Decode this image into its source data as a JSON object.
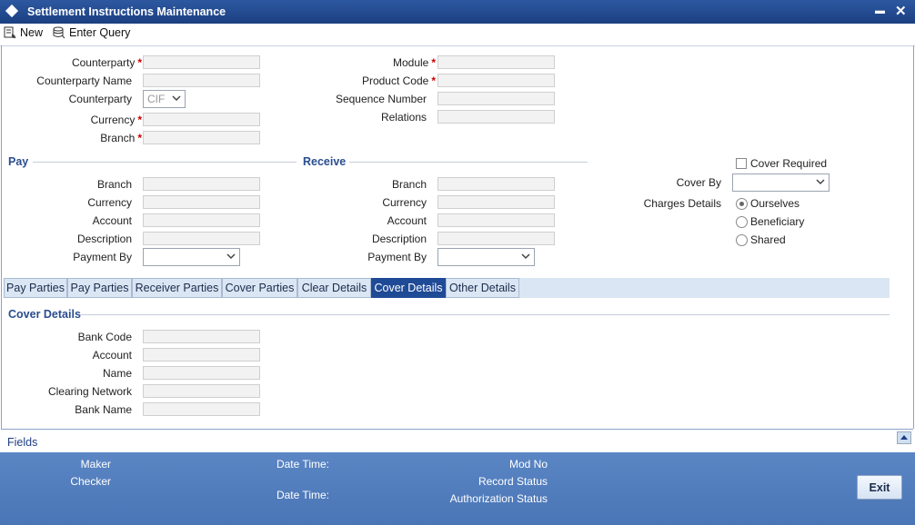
{
  "window": {
    "title": "Settlement Instructions Maintenance",
    "minimize_glyph": "▬",
    "close_glyph": "✕"
  },
  "toolbar": {
    "new_label": "New",
    "enter_query_label": "Enter Query"
  },
  "header": {
    "counterparty_label": "Counterparty",
    "counterparty_name_label": "Counterparty Name",
    "counterparty_type_label": "Counterparty",
    "counterparty_type_value": "CIF",
    "currency_label": "Currency",
    "branch_label": "Branch",
    "module_label": "Module",
    "product_code_label": "Product Code",
    "sequence_number_label": "Sequence Number",
    "relations_label": "Relations",
    "required_marker": "*"
  },
  "pay": {
    "title": "Pay",
    "branch_label": "Branch",
    "currency_label": "Currency",
    "account_label": "Account",
    "description_label": "Description",
    "payment_by_label": "Payment By"
  },
  "receive": {
    "title": "Receive",
    "branch_label": "Branch",
    "currency_label": "Currency",
    "account_label": "Account",
    "description_label": "Description",
    "payment_by_label": "Payment By"
  },
  "cover": {
    "cover_required_label": "Cover Required",
    "cover_by_label": "Cover By",
    "charges_details_label": "Charges Details",
    "charges_options": [
      "Ourselves",
      "Beneficiary",
      "Shared"
    ],
    "charges_selected": "Ourselves"
  },
  "tabs": [
    "Pay Parties",
    "Pay Parties",
    "Receiver Parties",
    "Cover Parties",
    "Clear Details",
    "Cover Details",
    "Other Details"
  ],
  "active_tab": "Cover Details",
  "cover_details": {
    "title": "Cover Details",
    "bank_code_label": "Bank Code",
    "account_label": "Account",
    "name_label": "Name",
    "clearing_network_label": "Clearing Network",
    "bank_name_label": "Bank Name"
  },
  "fields_bar": {
    "label": "Fields"
  },
  "footer": {
    "maker_label": "Maker",
    "checker_label": "Checker",
    "date_time_label_1": "Date Time:",
    "date_time_label_2": "Date Time:",
    "mod_no_label": "Mod No",
    "record_status_label": "Record Status",
    "authorization_status_label": "Authorization Status",
    "exit_label": "Exit"
  },
  "colors": {
    "title_bar": "#1b3f82",
    "section_title": "#2a4d8f",
    "active_tab": "#1f4a96",
    "footer": "#4a75b6",
    "required": "#cc0000"
  }
}
